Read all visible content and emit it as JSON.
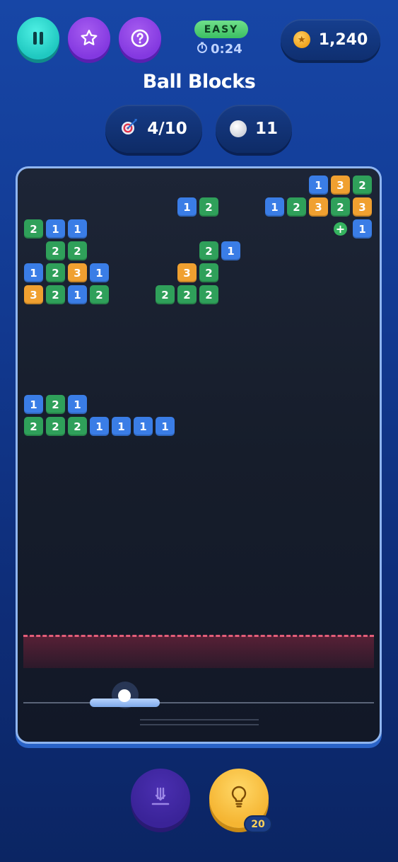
{
  "header": {
    "pause_button": {
      "icon": "pause-icon"
    },
    "favorite_button": {
      "icon": "star-icon"
    },
    "help_button": {
      "icon": "question-icon"
    },
    "difficulty": "EASY",
    "timer": "0:24",
    "coins": "1,240"
  },
  "title": "Ball Blocks",
  "stats": {
    "targets": "4/10",
    "balls": "11"
  },
  "board": {
    "blocks": [
      {
        "row": 0,
        "col": 13,
        "value": "1"
      },
      {
        "row": 0,
        "col": 14,
        "value": "3"
      },
      {
        "row": 0,
        "col": 15,
        "value": "2"
      },
      {
        "row": 1,
        "col": 7,
        "value": "1"
      },
      {
        "row": 1,
        "col": 8,
        "value": "2"
      },
      {
        "row": 1,
        "col": 11,
        "value": "1"
      },
      {
        "row": 1,
        "col": 12,
        "value": "2"
      },
      {
        "row": 1,
        "col": 13,
        "value": "3"
      },
      {
        "row": 1,
        "col": 14,
        "value": "2"
      },
      {
        "row": 1,
        "col": 15,
        "value": "3"
      },
      {
        "row": 2,
        "col": 0,
        "value": "2"
      },
      {
        "row": 2,
        "col": 1,
        "value": "1"
      },
      {
        "row": 2,
        "col": 2,
        "value": "1"
      },
      {
        "row": 2,
        "col": 15,
        "value": "1"
      },
      {
        "row": 3,
        "col": 1,
        "value": "2"
      },
      {
        "row": 3,
        "col": 2,
        "value": "2"
      },
      {
        "row": 3,
        "col": 8,
        "value": "2"
      },
      {
        "row": 3,
        "col": 9,
        "value": "1"
      },
      {
        "row": 4,
        "col": 0,
        "value": "1"
      },
      {
        "row": 4,
        "col": 1,
        "value": "2"
      },
      {
        "row": 4,
        "col": 2,
        "value": "3"
      },
      {
        "row": 4,
        "col": 3,
        "value": "1"
      },
      {
        "row": 4,
        "col": 7,
        "value": "3"
      },
      {
        "row": 4,
        "col": 8,
        "value": "2"
      },
      {
        "row": 5,
        "col": 0,
        "value": "3"
      },
      {
        "row": 5,
        "col": 1,
        "value": "2"
      },
      {
        "row": 5,
        "col": 2,
        "value": "1"
      },
      {
        "row": 5,
        "col": 3,
        "value": "2"
      },
      {
        "row": 5,
        "col": 6,
        "value": "2"
      },
      {
        "row": 5,
        "col": 7,
        "value": "2"
      },
      {
        "row": 5,
        "col": 8,
        "value": "2"
      },
      {
        "row": 10,
        "col": 0,
        "value": "1"
      },
      {
        "row": 10,
        "col": 1,
        "value": "2"
      },
      {
        "row": 10,
        "col": 2,
        "value": "1"
      },
      {
        "row": 11,
        "col": 0,
        "value": "2"
      },
      {
        "row": 11,
        "col": 1,
        "value": "2"
      },
      {
        "row": 11,
        "col": 2,
        "value": "2"
      },
      {
        "row": 11,
        "col": 3,
        "value": "1"
      },
      {
        "row": 11,
        "col": 4,
        "value": "1"
      },
      {
        "row": 11,
        "col": 5,
        "value": "1"
      },
      {
        "row": 11,
        "col": 6,
        "value": "1"
      }
    ],
    "powerups": [
      {
        "row": 2,
        "col": 14,
        "symbol": "+"
      }
    ],
    "colors": {
      "1": "#3a7de6",
      "2": "#2fa05a",
      "3": "#f0a030"
    }
  },
  "actions": {
    "drop_button": {
      "icon": "drop-down-icon"
    },
    "hint_button": {
      "icon": "lightbulb-icon",
      "count": "20"
    }
  }
}
